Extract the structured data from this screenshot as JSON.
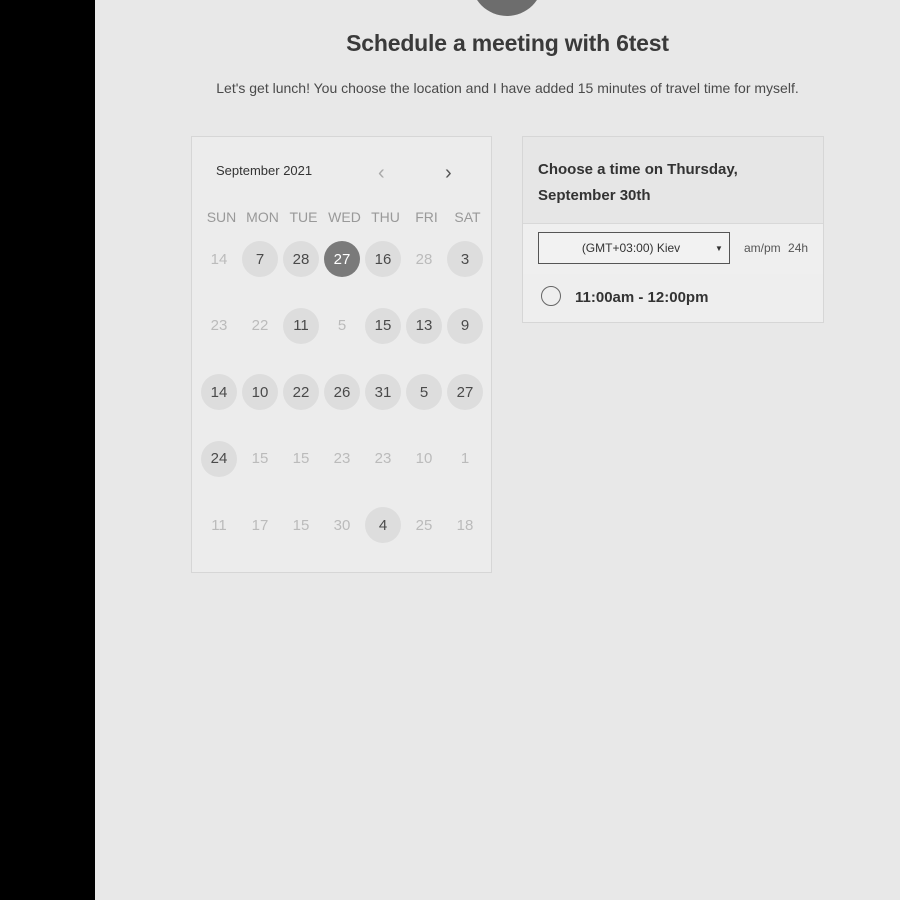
{
  "header": {
    "title": "Schedule a meeting with 6test",
    "subtitle": "Let's get lunch! You choose the location and I have added 15 minutes of travel time for myself."
  },
  "calendar": {
    "month_label": "September 2021",
    "prev_icon": "‹",
    "next_icon": "›",
    "weekdays": [
      "SUN",
      "MON",
      "TUE",
      "WED",
      "THU",
      "FRI",
      "SAT"
    ],
    "weeks": [
      [
        {
          "d": "14",
          "s": "muted"
        },
        {
          "d": "7",
          "s": "avail"
        },
        {
          "d": "28",
          "s": "avail"
        },
        {
          "d": "27",
          "s": "selected"
        },
        {
          "d": "16",
          "s": "avail"
        },
        {
          "d": "28",
          "s": "muted"
        },
        {
          "d": "3",
          "s": "avail"
        }
      ],
      [
        {
          "d": "23",
          "s": "muted"
        },
        {
          "d": "22",
          "s": "muted"
        },
        {
          "d": "11",
          "s": "avail"
        },
        {
          "d": "5",
          "s": "muted"
        },
        {
          "d": "15",
          "s": "avail"
        },
        {
          "d": "13",
          "s": "avail"
        },
        {
          "d": "9",
          "s": "avail"
        }
      ],
      [
        {
          "d": "14",
          "s": "avail"
        },
        {
          "d": "10",
          "s": "avail"
        },
        {
          "d": "22",
          "s": "avail"
        },
        {
          "d": "26",
          "s": "avail"
        },
        {
          "d": "31",
          "s": "avail"
        },
        {
          "d": "5",
          "s": "avail"
        },
        {
          "d": "27",
          "s": "avail"
        }
      ],
      [
        {
          "d": "24",
          "s": "avail"
        },
        {
          "d": "15",
          "s": "muted"
        },
        {
          "d": "15",
          "s": "muted"
        },
        {
          "d": "23",
          "s": "muted"
        },
        {
          "d": "23",
          "s": "muted"
        },
        {
          "d": "10",
          "s": "muted"
        },
        {
          "d": "1",
          "s": "muted"
        }
      ],
      [
        {
          "d": "11",
          "s": "muted"
        },
        {
          "d": "17",
          "s": "muted"
        },
        {
          "d": "15",
          "s": "muted"
        },
        {
          "d": "30",
          "s": "muted"
        },
        {
          "d": "4",
          "s": "avail"
        },
        {
          "d": "25",
          "s": "muted"
        },
        {
          "d": "18",
          "s": "muted"
        }
      ]
    ]
  },
  "panel": {
    "heading": "Choose a time on Thursday, September 30th",
    "timezone_value": "(GMT+03:00) Kiev",
    "timezone_caret": "▼",
    "format_ampm": "am/pm",
    "format_24h": "24h",
    "slots": [
      {
        "label": "11:00am - 12:00pm"
      }
    ]
  }
}
